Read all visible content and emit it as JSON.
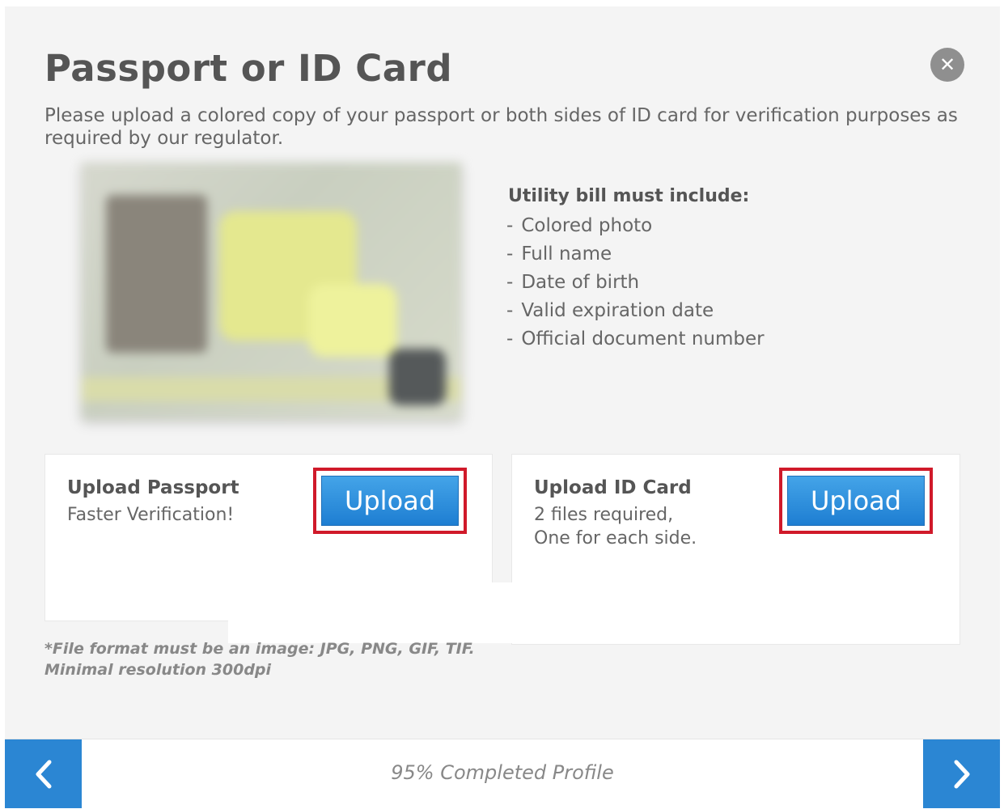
{
  "modal": {
    "title": "Passport or ID Card",
    "description": "Please upload a colored copy of your passport or both sides of ID card for verification purposes as required by our regulator."
  },
  "requirements": {
    "heading": "Utility bill must include:",
    "items": [
      {
        "dash": "-",
        "text": "Colored photo"
      },
      {
        "dash": "-",
        "text": "Full name"
      },
      {
        "dash": "-",
        "text": "Date of birth"
      },
      {
        "dash": "-",
        "text": "Valid expiration date"
      },
      {
        "dash": "-",
        "text": "Official document number"
      }
    ]
  },
  "passport_card": {
    "title": "Upload Passport",
    "subtitle": "Faster Verification!",
    "button": "Upload"
  },
  "id_card": {
    "title": "Upload ID Card",
    "line1": "2 files required,",
    "line2": "One for each side.",
    "button": "Upload"
  },
  "note": {
    "line1": "*File format must be an image: JPG, PNG, GIF, TIF.",
    "line2": "Minimal resolution 300dpi"
  },
  "footer": {
    "progress_value": "95%",
    "progress_label": "Completed Profile",
    "prev_icon": "chevron-left-icon",
    "next_icon": "chevron-right-icon"
  },
  "colors": {
    "accent": "#2b86d3",
    "highlight": "#d01a2a",
    "close_bg": "#8f8f8f"
  }
}
